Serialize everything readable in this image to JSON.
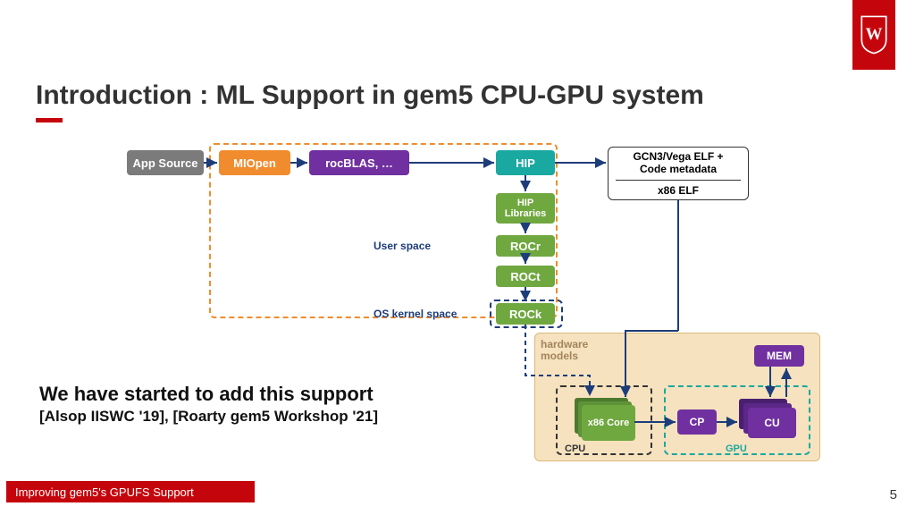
{
  "title": "Introduction : ML Support in gem5 CPU-GPU system",
  "boxes": {
    "app": "App Source",
    "miopen": "MIOpen",
    "rocblas": "rocBLAS, …",
    "hip": "HIP",
    "hip_lib": "HIP Libraries",
    "rocr": "ROCr",
    "roct": "ROCt",
    "rock": "ROCk",
    "mem": "MEM",
    "cp": "CP",
    "cu": "CU",
    "x86core": "x86 Core"
  },
  "elf": {
    "line1": "GCN3/Vega ELF +",
    "line2": "Code metadata",
    "x86": "x86 ELF"
  },
  "labels": {
    "user_space": "User space",
    "os_kernel": "OS kernel space",
    "hw_models": "hardware models",
    "cpu": "CPU",
    "gpu": "GPU"
  },
  "support": {
    "main": "We have started to add this support",
    "sub": "[Alsop IISWC '19], [Roarty gem5 Workshop '21]"
  },
  "footer": "Improving gem5's GPUFS Support",
  "page": "5"
}
